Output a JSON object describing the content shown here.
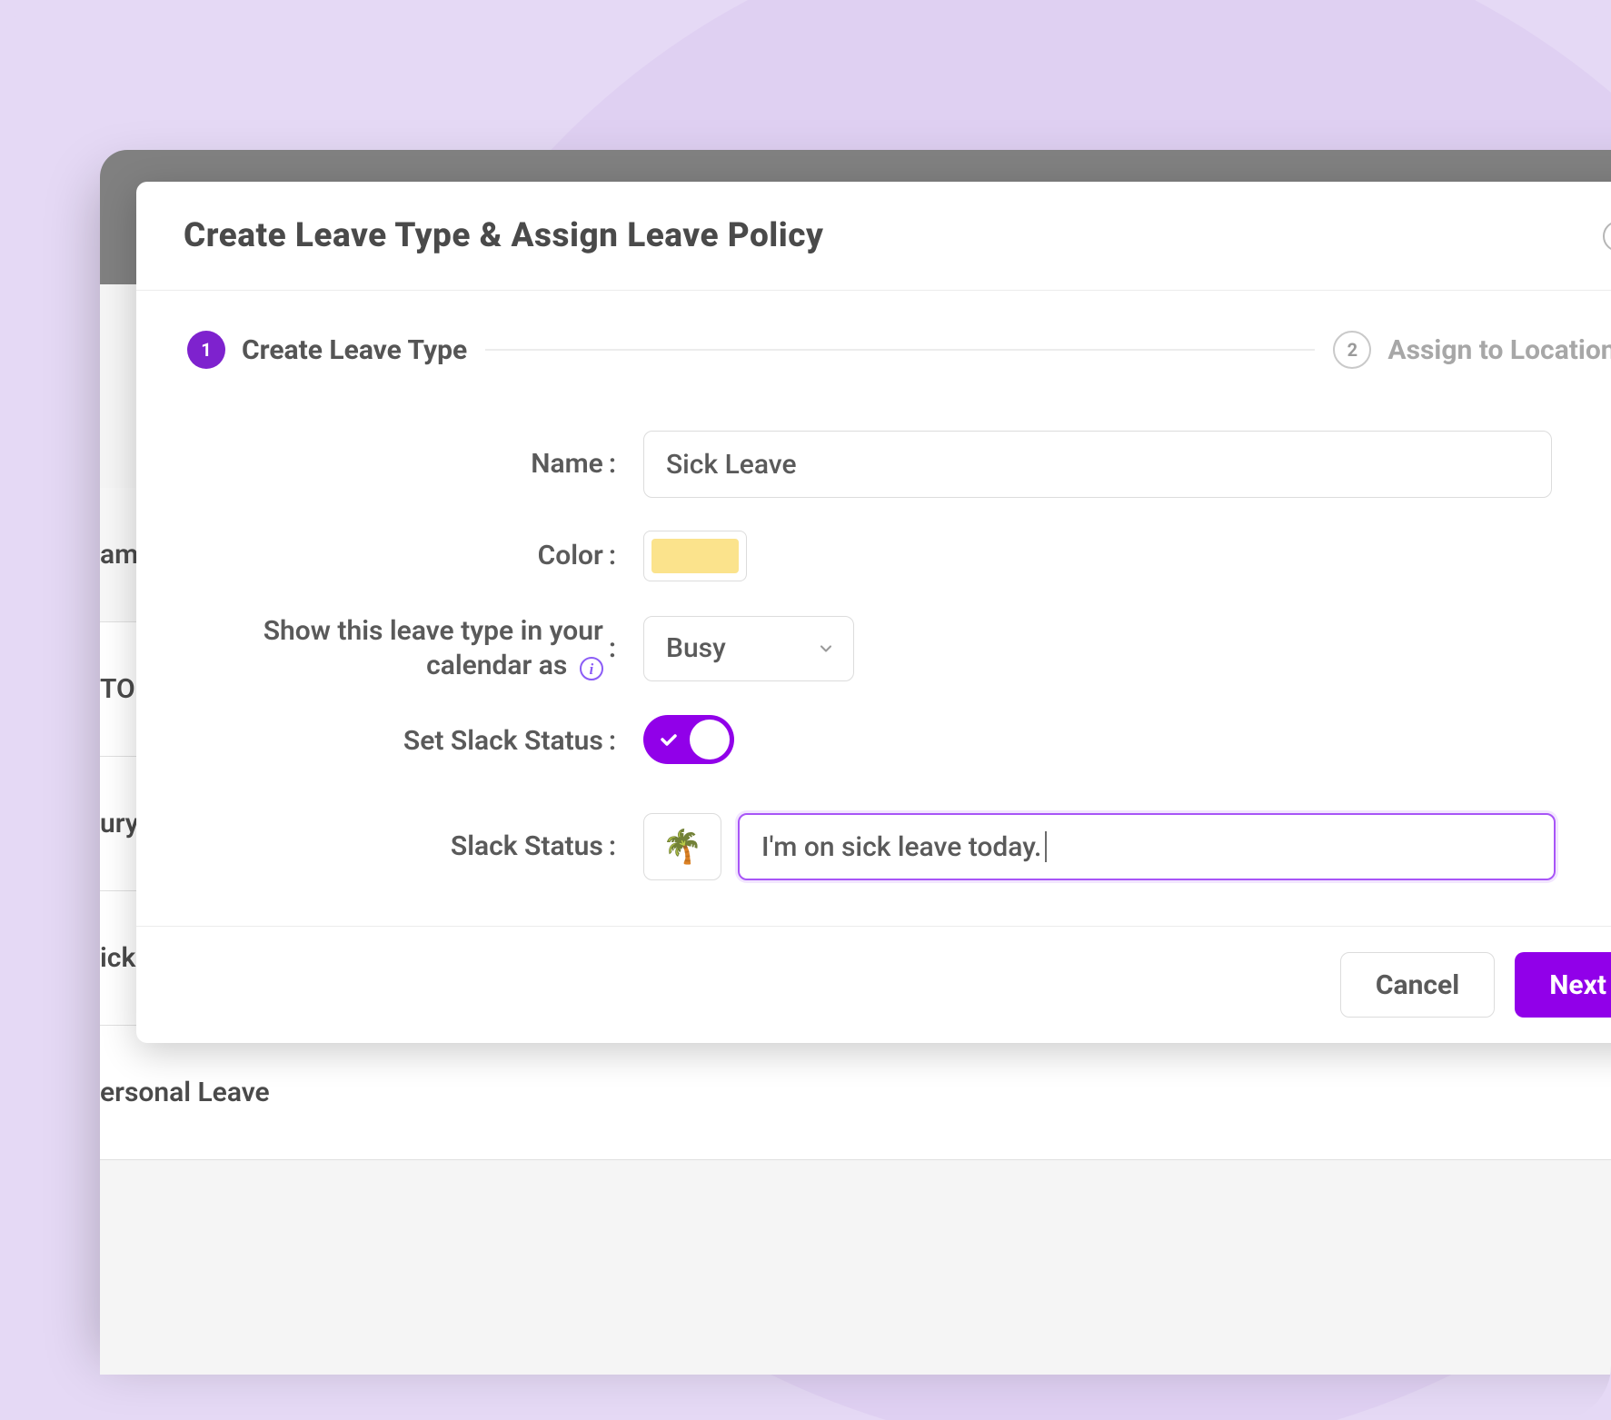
{
  "modal": {
    "title": "Create Leave Type & Assign Leave Policy",
    "steps": [
      {
        "num": "1",
        "label": "Create Leave Type",
        "active": true
      },
      {
        "num": "2",
        "label": "Assign to Locations",
        "active": false
      }
    ],
    "form": {
      "name_label": "Name",
      "name_value": "Sick Leave",
      "color_label": "Color",
      "color_value": "#fbe38c",
      "calendar_label": "Show this leave type in your calendar as",
      "calendar_value": "Busy",
      "set_slack_label": "Set Slack Status",
      "set_slack_on": true,
      "slack_status_label": "Slack Status",
      "slack_emoji": "🌴",
      "slack_text": "I'm on sick leave today."
    },
    "footer": {
      "cancel": "Cancel",
      "next": "Next"
    }
  },
  "background_rows": [
    "am",
    "TO",
    "ury",
    "ick",
    "ersonal Leave"
  ]
}
